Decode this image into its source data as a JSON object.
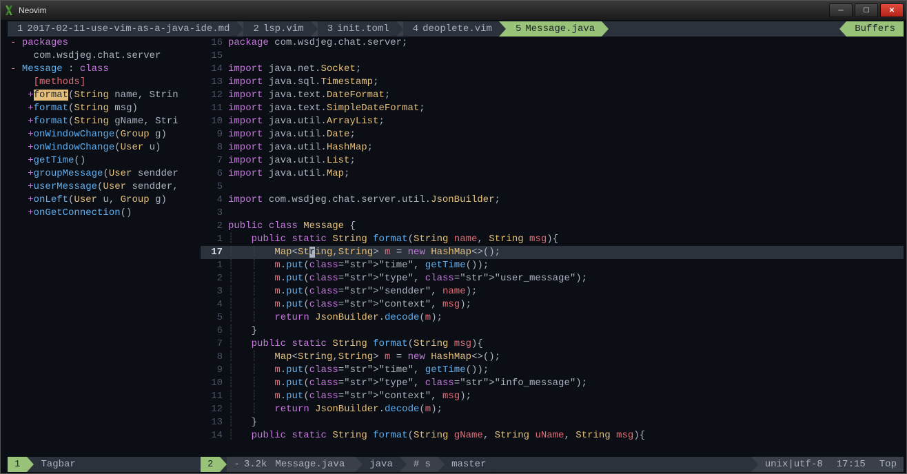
{
  "window": {
    "title": "Neovim"
  },
  "tabline": {
    "tabs": [
      {
        "num": "1",
        "label": "2017-02-11-use-vim-as-a-java-ide.md"
      },
      {
        "num": "2",
        "label": "lsp.vim"
      },
      {
        "num": "3",
        "label": "init.toml"
      },
      {
        "num": "4",
        "label": "deoplete.vim"
      },
      {
        "num": "5",
        "label": "Message.java"
      }
    ],
    "buffers_label": "Buffers"
  },
  "sidebar": {
    "packages_kw": "packages",
    "package_name": "com.wsdjeg.chat.server",
    "class_name": "Message",
    "class_kw": "class",
    "methods_label": "[methods]",
    "methods": [
      {
        "name": "format",
        "sig": "(String name, Strin",
        "hl": true
      },
      {
        "name": "format",
        "sig": "(String msg)"
      },
      {
        "name": "format",
        "sig": "(String gName, Stri"
      },
      {
        "name": "onWindowChange",
        "sig": "(Group g)"
      },
      {
        "name": "onWindowChange",
        "sig": "(User u)"
      },
      {
        "name": "getTime",
        "sig": "()"
      },
      {
        "name": "groupMessage",
        "sig": "(User sendder"
      },
      {
        "name": "userMessage",
        "sig": "(User sendder,"
      },
      {
        "name": "onLeft",
        "sig": "(User u, Group g)"
      },
      {
        "name": "onGetConnection",
        "sig": "()"
      }
    ]
  },
  "code": {
    "lines": [
      {
        "n": "16",
        "t": "package com.wsdjeg.chat.server;"
      },
      {
        "n": "15",
        "t": ""
      },
      {
        "n": "14",
        "t": "import java.net.Socket;"
      },
      {
        "n": "13",
        "t": "import java.sql.Timestamp;"
      },
      {
        "n": "12",
        "t": "import java.text.DateFormat;"
      },
      {
        "n": "11",
        "t": "import java.text.SimpleDateFormat;"
      },
      {
        "n": "10",
        "t": "import java.util.ArrayList;"
      },
      {
        "n": "9",
        "t": "import java.util.Date;"
      },
      {
        "n": "8",
        "t": "import java.util.HashMap;"
      },
      {
        "n": "7",
        "t": "import java.util.List;"
      },
      {
        "n": "6",
        "t": "import java.util.Map;"
      },
      {
        "n": "5",
        "t": ""
      },
      {
        "n": "4",
        "t": "import com.wsdjeg.chat.server.util.JsonBuilder;"
      },
      {
        "n": "3",
        "t": ""
      },
      {
        "n": "2",
        "t": "public class Message {"
      },
      {
        "n": "1",
        "t": "    public static String format(String name, String msg){"
      },
      {
        "n": "17",
        "t": "        Map<String,String> m = new HashMap<>();",
        "cur": true
      },
      {
        "n": "1",
        "t": "        m.put(\"time\", getTime());"
      },
      {
        "n": "2",
        "t": "        m.put(\"type\", \"user_message\");"
      },
      {
        "n": "3",
        "t": "        m.put(\"sendder\", name);"
      },
      {
        "n": "4",
        "t": "        m.put(\"context\", msg);"
      },
      {
        "n": "5",
        "t": "        return JsonBuilder.decode(m);"
      },
      {
        "n": "6",
        "t": "    }"
      },
      {
        "n": "7",
        "t": "    public static String format(String msg){"
      },
      {
        "n": "8",
        "t": "        Map<String,String> m = new HashMap<>();"
      },
      {
        "n": "9",
        "t": "        m.put(\"time\", getTime());"
      },
      {
        "n": "10",
        "t": "        m.put(\"type\", \"info_message\");"
      },
      {
        "n": "11",
        "t": "        m.put(\"context\", msg);"
      },
      {
        "n": "12",
        "t": "        return JsonBuilder.decode(m);"
      },
      {
        "n": "13",
        "t": "    }"
      },
      {
        "n": "14",
        "t": "    public static String format(String gName, String uName, String msg){"
      }
    ]
  },
  "status_left": {
    "num": "1",
    "title": "Tagbar"
  },
  "status_right": {
    "num": "2",
    "filesize": "3.2k",
    "filename": "Message.java",
    "filetype": "java",
    "gitinfo": "# s",
    "branch": "master",
    "fileformat": "unix",
    "encoding": "utf-8",
    "time": "17:15",
    "position": "Top"
  }
}
